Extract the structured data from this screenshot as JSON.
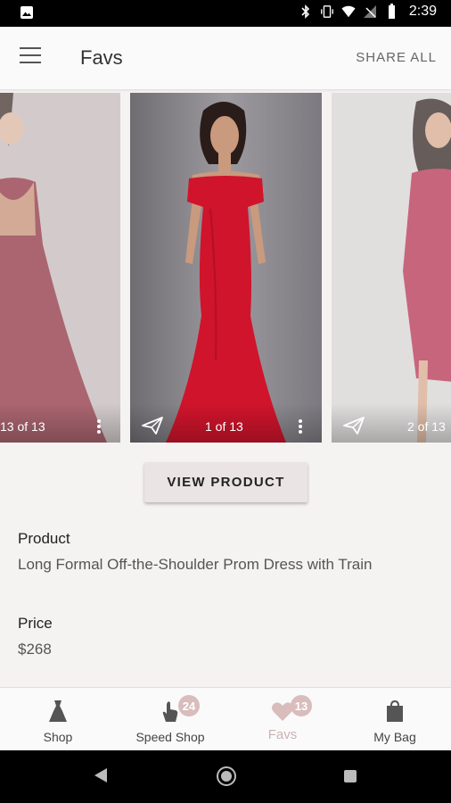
{
  "status_bar": {
    "time": "2:39"
  },
  "app_bar": {
    "title": "Favs",
    "share_all": "SHARE ALL"
  },
  "carousel": {
    "cards": [
      {
        "counter": "13 of 13",
        "dress_color": "#8a2a3a"
      },
      {
        "counter": "1 of 13",
        "dress_color": "#d0142c"
      },
      {
        "counter": "2 of 13",
        "dress_color": "#b22a4a"
      }
    ]
  },
  "view_product": "VIEW PRODUCT",
  "product": {
    "label": "Product",
    "name": "Long Formal Off-the-Shoulder Prom Dress with Train"
  },
  "price": {
    "label": "Price",
    "value": "$268"
  },
  "bottom_nav": {
    "shop": "Shop",
    "speed_shop": "Speed Shop",
    "speed_shop_badge": "24",
    "favs": "Favs",
    "favs_badge": "13",
    "my_bag": "My Bag"
  },
  "colors": {
    "accent": "#d9bcbc",
    "background": "#f5f2f2"
  }
}
